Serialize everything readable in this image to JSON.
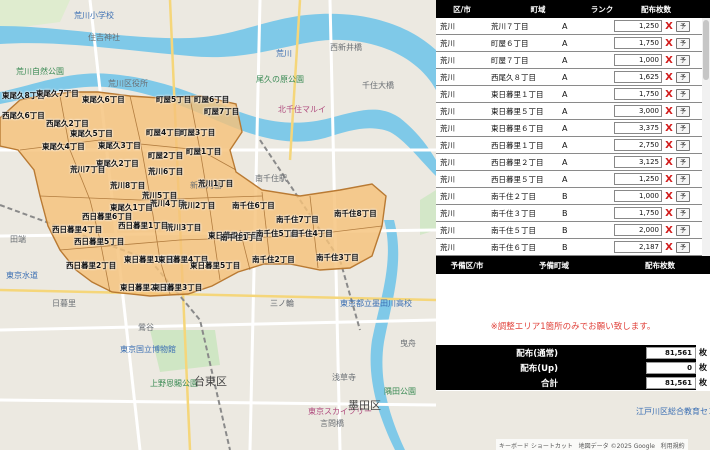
{
  "map": {
    "poi": [
      {
        "id": "school-top",
        "text": "荒川小学校"
      },
      {
        "id": "sumiyoshi",
        "text": "住吉神社"
      },
      {
        "id": "arakawa-park",
        "text": "荒川自然公園"
      },
      {
        "id": "tanezaki",
        "text": "尾久の原公園"
      },
      {
        "id": "arakawa-city",
        "text": "荒川区役所"
      },
      {
        "id": "senju-ohashi",
        "text": "千住大橋"
      },
      {
        "id": "kita-senju",
        "text": "北千住マルイ"
      },
      {
        "id": "minamisenju",
        "text": "南千住駅"
      },
      {
        "id": "asakusa",
        "text": "浅草寺"
      },
      {
        "id": "tokyo-museum",
        "text": "東京国立博物館"
      },
      {
        "id": "ueno-park",
        "text": "上野恩賜公園"
      },
      {
        "id": "oshiage",
        "text": "東京スカイツリー"
      },
      {
        "id": "sumida-park",
        "text": "隅田公園"
      },
      {
        "id": "uguisudani",
        "text": "鶯谷"
      },
      {
        "id": "nippori",
        "text": "日暮里"
      },
      {
        "id": "minowa",
        "text": "三ノ輪"
      },
      {
        "id": "kotoi",
        "text": "言問橋"
      },
      {
        "id": "hikifune",
        "text": "曳舟"
      },
      {
        "id": "tokyo-kaikan",
        "text": "江戸川区総合教育センター"
      },
      {
        "id": "edo",
        "text": "東京都立墨田川高校"
      },
      {
        "id": "nishiarai",
        "text": "西新井橋"
      },
      {
        "id": "tokyo-suido",
        "text": "東京水道"
      },
      {
        "id": "shin-mikawashima",
        "text": "新三河島"
      },
      {
        "id": "tabata",
        "text": "田端"
      }
    ],
    "district_labels": [
      {
        "id": "taito",
        "text": "台東区"
      },
      {
        "id": "sumida",
        "text": "墨田区"
      },
      {
        "id": "arakawa-main",
        "text": "荒川"
      }
    ],
    "towns": [
      "東尾久8丁目",
      "東尾久7丁目",
      "東尾久6丁目",
      "西尾久6丁目",
      "西尾久2丁目",
      "東尾久5丁目",
      "東尾久4丁目",
      "東尾久3丁目",
      "町屋5丁目",
      "町屋6丁目",
      "町屋7丁目",
      "町屋4丁目",
      "町屋3丁目",
      "町屋2丁目",
      "町屋1丁目",
      "東尾久2丁目",
      "荒川7丁目",
      "荒川6丁目",
      "荒川5丁目",
      "荒川8丁目",
      "荒川4丁目",
      "荒川2丁目",
      "荒川1丁目",
      "荒川3丁目",
      "東尾久1丁目",
      "西日暮里6丁目",
      "西日暮里4丁目",
      "西日暮里5丁目",
      "西日暮里1丁目",
      "西日暮里2丁目",
      "東日暮里1丁目",
      "東日暮里2丁目",
      "東日暮里3丁目",
      "東日暮里4丁目",
      "東日暮里5丁目",
      "東日暮里6丁目",
      "南千住6丁目",
      "南千住8丁目",
      "南千住7丁目",
      "南千住1丁目",
      "南千住2丁目",
      "南千住3丁目",
      "南千住4丁目",
      "南千住5丁目"
    ],
    "footer": {
      "keyboard": "キーボード ショートカット",
      "data": "地図データ ©2025 Google",
      "terms": "利用規約"
    }
  },
  "table": {
    "headers": {
      "area": "区/市",
      "town": "町域",
      "rank": "ランク",
      "count": "配布枚数"
    },
    "rows": [
      {
        "area": "荒川",
        "town": "荒川７丁目",
        "rank": "A",
        "count": "1,250"
      },
      {
        "area": "荒川",
        "town": "町屋６丁目",
        "rank": "A",
        "count": "1,750"
      },
      {
        "area": "荒川",
        "town": "町屋７丁目",
        "rank": "A",
        "count": "1,000"
      },
      {
        "area": "荒川",
        "town": "西尾久８丁目",
        "rank": "A",
        "count": "1,625"
      },
      {
        "area": "荒川",
        "town": "東日暮里１丁目",
        "rank": "A",
        "count": "1,750"
      },
      {
        "area": "荒川",
        "town": "東日暮里５丁目",
        "rank": "A",
        "count": "3,000"
      },
      {
        "area": "荒川",
        "town": "東日暮里６丁目",
        "rank": "A",
        "count": "3,375"
      },
      {
        "area": "荒川",
        "town": "西日暮里１丁目",
        "rank": "A",
        "count": "2,750"
      },
      {
        "area": "荒川",
        "town": "西日暮里２丁目",
        "rank": "A",
        "count": "3,125"
      },
      {
        "area": "荒川",
        "town": "西日暮里５丁目",
        "rank": "A",
        "count": "1,250"
      },
      {
        "area": "荒川",
        "town": "南千住２丁目",
        "rank": "B",
        "count": "1,000"
      },
      {
        "area": "荒川",
        "town": "南千住３丁目",
        "rank": "B",
        "count": "1,750"
      },
      {
        "area": "荒川",
        "town": "南千住５丁目",
        "rank": "B",
        "count": "2,000"
      },
      {
        "area": "荒川",
        "town": "南千住６丁目",
        "rank": "B",
        "count": "2,187"
      },
      {
        "area": "荒川",
        "town": "南千住７丁目",
        "rank": "B",
        "count": "1,625"
      }
    ],
    "delete_symbol": "X",
    "reserve_label": "予"
  },
  "reserve": {
    "headers": {
      "area": "予備区/市",
      "town": "予備町域",
      "count": "配布枚数"
    }
  },
  "notice": "※調整エリア1箇所のみでお願い致します。",
  "totals": [
    {
      "label": "配布(通常)",
      "value": "81,561",
      "unit": "枚"
    },
    {
      "label": "配布(Up)",
      "value": "0",
      "unit": "枚"
    },
    {
      "label": "合計",
      "value": "81,561",
      "unit": "枚"
    }
  ],
  "colors": {
    "area_fill": "#f5c27a",
    "river": "#7fc9e8",
    "delete_x": "#d21b1b",
    "notice": "#e0413a"
  }
}
